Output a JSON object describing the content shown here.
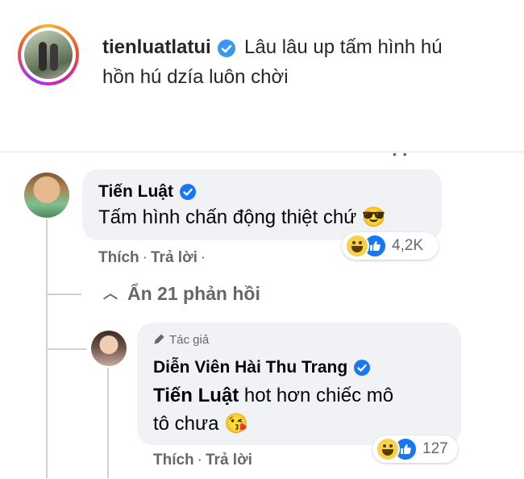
{
  "instagram": {
    "username": "tienluatlatui",
    "caption_line1": "Lâu lâu up tấm hình hú",
    "caption_line2": "hồn hú dzía luôn chời"
  },
  "comments": [
    {
      "author": "Tiến Luật",
      "text": "Tấm hình chấn động thiệt chứ 😎",
      "like_label": "Thích",
      "reply_label": "Trả lời",
      "trailing_dot": "·",
      "reaction_count": "4,2K"
    }
  ],
  "hide_replies_label": "Ẩn 21 phản hồi",
  "reply": {
    "badge": "Tác giả",
    "author": "Diễn Viên Hài Thu Trang",
    "mention": "Tiến Luật",
    "text_line1": " hot hơn chiếc mô",
    "text_line2": "tô chưa 😘",
    "like_label": "Thích",
    "reply_label": "Trả lời",
    "reaction_count": "127"
  },
  "colors": {
    "verified_blue": "#3897f0",
    "fb_blue": "#1877f2",
    "bubble_bg": "#f0f2f5",
    "meta_gray": "#65676b"
  }
}
